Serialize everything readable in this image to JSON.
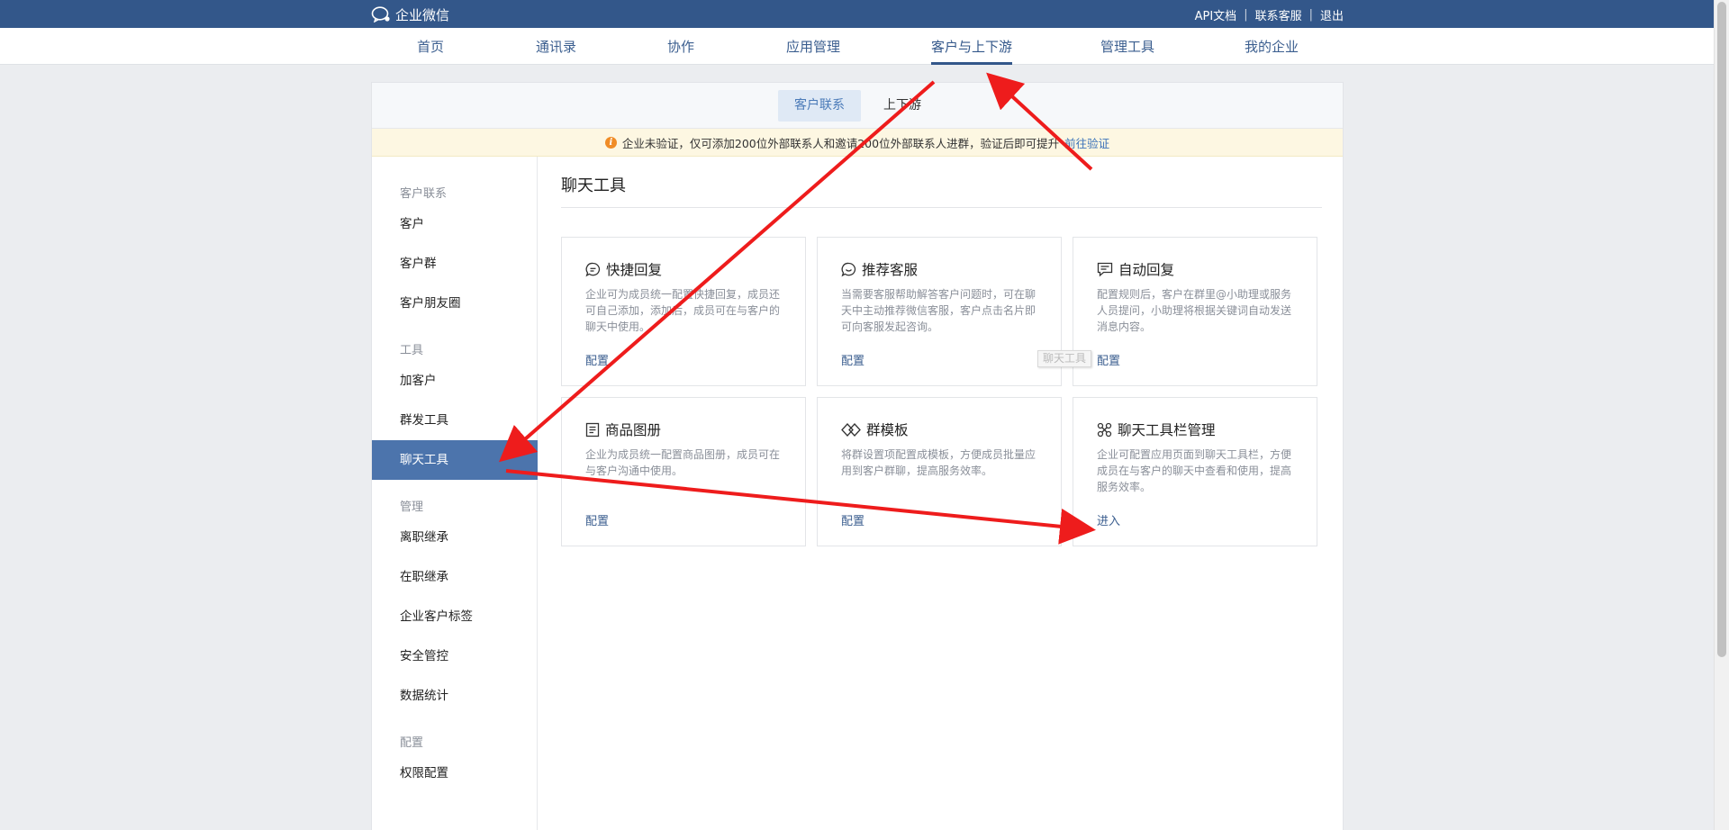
{
  "brand": {
    "name": "企业微信"
  },
  "top_links": {
    "api_docs": "API文档",
    "support": "联系客服",
    "logout": "退出",
    "sep": "|"
  },
  "main_nav": {
    "tabs": [
      {
        "label": "首页"
      },
      {
        "label": "通讯录"
      },
      {
        "label": "协作"
      },
      {
        "label": "应用管理"
      },
      {
        "label": "客户与上下游",
        "active": true
      },
      {
        "label": "管理工具"
      },
      {
        "label": "我的企业"
      }
    ]
  },
  "sub_tabs": {
    "active": "客户联系",
    "other": "上下游"
  },
  "notice": {
    "text": "企业未验证，仅可添加200位外部联系人和邀请200位外部联系人进群，验证后即可提升",
    "link": "前往验证"
  },
  "sidebar": {
    "groups": [
      {
        "title": "客户联系",
        "items": [
          "客户",
          "客户群",
          "客户朋友圈"
        ]
      },
      {
        "title": "工具",
        "items": [
          "加客户",
          "群发工具",
          "聊天工具"
        ]
      },
      {
        "title": "管理",
        "items": [
          "离职继承",
          "在职继承",
          "企业客户标签",
          "安全管控",
          "数据统计"
        ]
      },
      {
        "title": "配置",
        "items": [
          "权限配置"
        ]
      }
    ],
    "active_item": "聊天工具"
  },
  "content": {
    "title": "聊天工具",
    "cards": [
      {
        "title": "快捷回复",
        "icon": "quick-reply-icon",
        "desc": "企业可为成员统一配置快捷回复，成员还可自己添加，添加后，成员可在与客户的聊天中使用。",
        "action": "配置"
      },
      {
        "title": "推荐客服",
        "icon": "recommend-service-icon",
        "desc": "当需要客服帮助解答客户问题时，可在聊天中主动推荐微信客服，客户点击名片即可向客服发起咨询。",
        "action": "配置"
      },
      {
        "title": "自动回复",
        "icon": "auto-reply-icon",
        "desc": "配置规则后，客户在群里@小助理或服务人员提问，小助理将根据关键词自动发送消息内容。",
        "action": "配置"
      },
      {
        "title": "商品图册",
        "icon": "product-album-icon",
        "desc": "企业为成员统一配置商品图册，成员可在与客户沟通中使用。",
        "action": "配置"
      },
      {
        "title": "群模板",
        "icon": "group-template-icon",
        "desc": "将群设置项配置成模板，方便成员批量应用到客户群聊，提高服务效率。",
        "action": "配置"
      },
      {
        "title": "聊天工具栏管理",
        "icon": "toolbar-manage-icon",
        "desc": "企业可配置应用页面到聊天工具栏，方便成员在与客户的聊天中查看和使用，提高服务效率。",
        "action": "进入"
      }
    ],
    "tooltip": "聊天工具"
  },
  "colors": {
    "topbar": "#33578a",
    "accent": "#4c74ac",
    "link": "#3b5e8f",
    "annotation_arrow": "#ee1c1c"
  }
}
